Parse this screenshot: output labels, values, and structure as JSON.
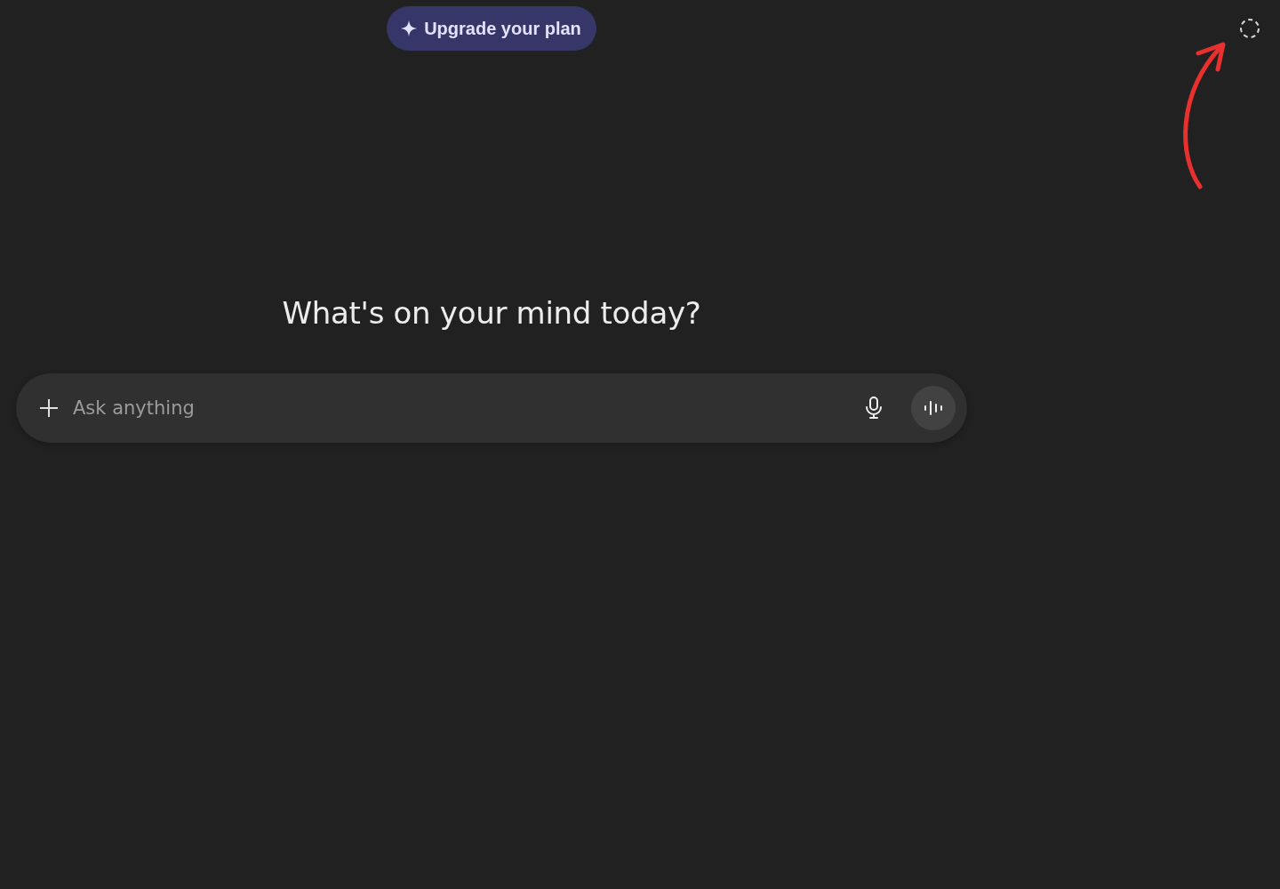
{
  "upgrade_button": {
    "label": "Upgrade your plan"
  },
  "heading": "What's on your mind today?",
  "composer": {
    "placeholder": "Ask anything"
  }
}
